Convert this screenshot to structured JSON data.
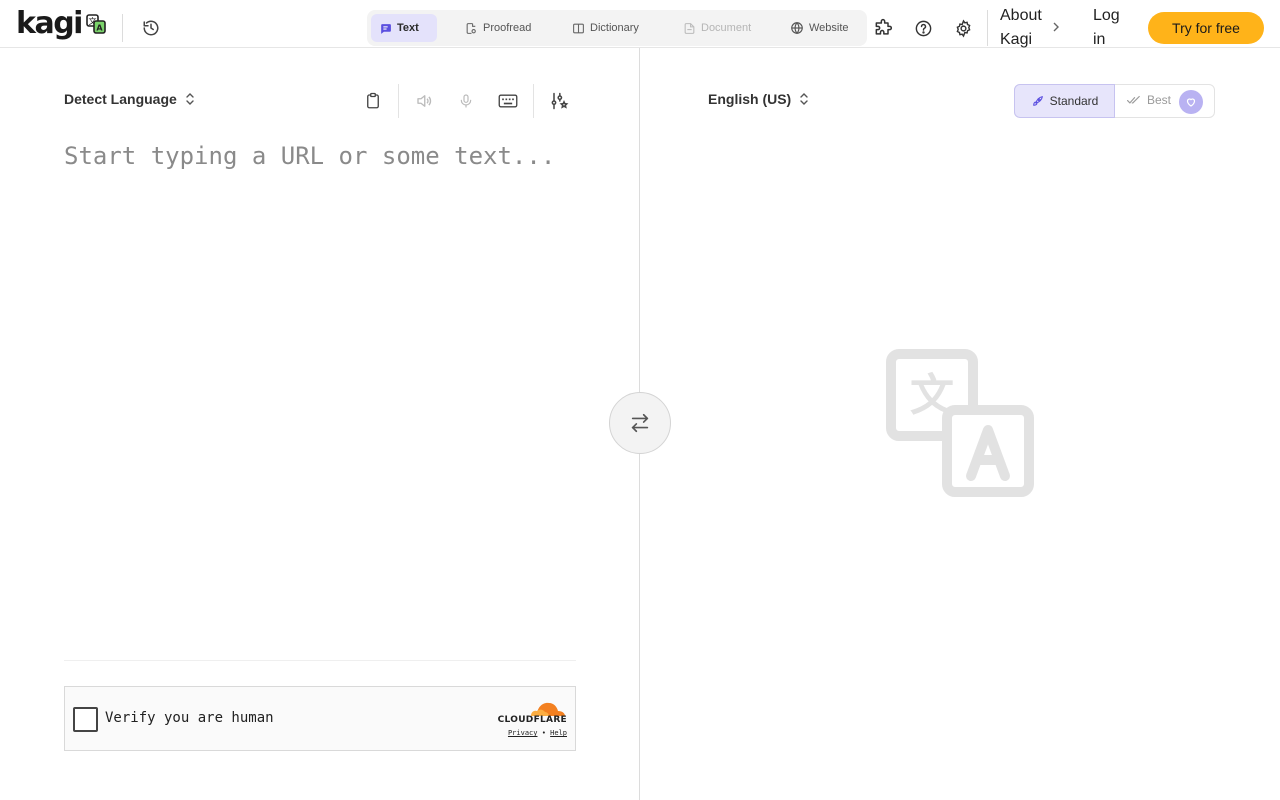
{
  "header": {
    "logo_text": "kagi",
    "modes": [
      {
        "label": "Text",
        "state": "active",
        "icon": "message-icon"
      },
      {
        "label": "Proofread",
        "state": "normal",
        "icon": "proofread-icon"
      },
      {
        "label": "Dictionary",
        "state": "normal",
        "icon": "book-icon"
      },
      {
        "label": "Document",
        "state": "disabled",
        "icon": "document-icon"
      },
      {
        "label": "Website",
        "state": "normal",
        "icon": "globe-icon"
      }
    ],
    "icons": [
      "history-icon",
      "puzzle-icon",
      "help-icon",
      "gear-icon"
    ],
    "about_label": "About Kagi",
    "login_label": "Log in",
    "cta_label": "Try for free",
    "cta_color": "#ffb319",
    "accent_color": "#e4e2fb"
  },
  "source": {
    "language": "Detect Language",
    "placeholder": "Start typing a URL or some text...",
    "value": "",
    "tools": [
      "clipboard-icon",
      "speaker-icon",
      "microphone-icon",
      "keyboard-icon",
      "settings-sliders-icon"
    ]
  },
  "captcha": {
    "label": "Verify you are human",
    "brand": "CLOUDFLARE",
    "privacy_label": "Privacy",
    "separator": "•",
    "help_label": "Help"
  },
  "target": {
    "language": "English (US)",
    "quality_options": [
      {
        "label": "Standard",
        "state": "active",
        "icon": "rocket-icon"
      },
      {
        "label": "Best",
        "state": "locked",
        "icon": "check-double-icon"
      }
    ],
    "empty_icon": "translate-icon"
  }
}
